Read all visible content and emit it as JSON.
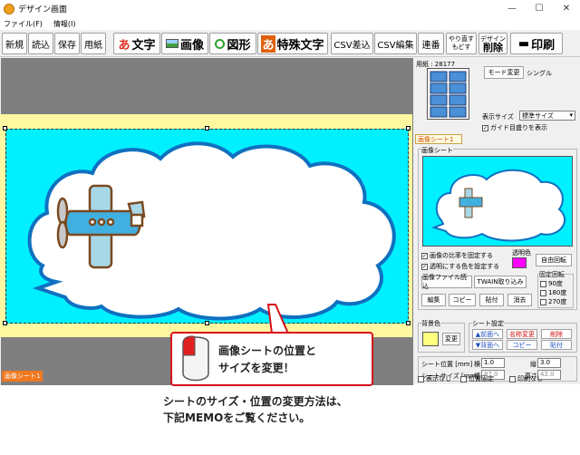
{
  "window": {
    "title": "デザイン画面",
    "controls": {
      "minimize": "—",
      "maximize": "☐",
      "close": "✕"
    }
  },
  "menu": {
    "items": [
      "ファイル(F)",
      "情報(I)"
    ]
  },
  "toolbar": {
    "new": "新規",
    "open": "読込",
    "save": "保存",
    "paper": "用紙",
    "text_icon": "あ",
    "text": "文字",
    "image": "画像",
    "shape": "図形",
    "special_icon": "あ",
    "special": "特殊文字",
    "csv_insert": "CSV差込",
    "csv_edit": "CSV編集",
    "serial": "連番",
    "redo": "やり直す",
    "undo": "もどす",
    "delete_top": "デザイン",
    "delete": "削除",
    "print": "印刷"
  },
  "panel": {
    "paper_label": "用紙 : 28177",
    "mode_button": "モード変更",
    "mode_value": "シングル",
    "display_size_label": "表示サイズ",
    "display_size_value": "標準サイズ",
    "guide_label": "ガイド目盛りを表示",
    "tab_label": "画像シート1",
    "image_sheet_label": "画像シート",
    "fix_ratio": "画像の比率を固定する",
    "transparent": "透明にする色を設定する",
    "transparent_color_label": "透明色",
    "transparent_color": "#ff00ff",
    "free_rotate": "自由回転",
    "load_file": "画像ファイル読込",
    "twain": "TWAIN取り込み",
    "rotate_fixed": "固定回転",
    "rot_90": "90度",
    "rot_180": "180度",
    "rot_270": "270度",
    "edit": "編集",
    "copy": "コピー",
    "paste": "貼付",
    "erase": "消去",
    "bg_color_label": "背景色",
    "bg_color": "#ffff80",
    "change": "変更",
    "sheet_setting": "シート設定",
    "to_front": "▲前面へ",
    "to_back": "▼背面へ",
    "rename_top": "名称変更",
    "rename_bottom": "コピー",
    "del_top": "削除",
    "del_bottom": "貼付",
    "pos_label": "シート位置 [mm]",
    "x_label": "横",
    "x_value": "1.0",
    "y_label": "縦",
    "y_value": "3.0",
    "size_label": "シートサイズ [mm]",
    "w_label": "幅",
    "w_value": "87.0",
    "h_label": "高さ",
    "h_value": "42.0",
    "hide": "表示なし",
    "fix_pos": "位置固定",
    "no_print": "印刷なし"
  },
  "canvas": {
    "sheet_tag": "画像シート1"
  },
  "callout": {
    "line1": "画像シートの位置と",
    "line2": "サイズを変更！"
  },
  "caption": {
    "line1": "シートのサイズ・位置の変更方法は、",
    "line2": "下記MEMOをご覧ください。"
  },
  "colors": {
    "accent": "#d8101a",
    "sheet": "#00f0ff",
    "paper": "#fff8a0"
  }
}
